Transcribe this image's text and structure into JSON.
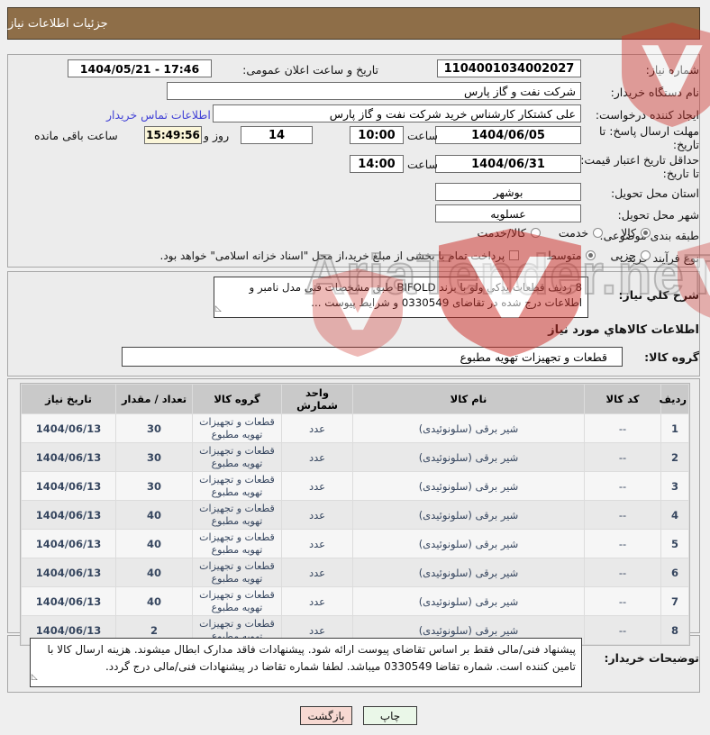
{
  "page": {
    "title_bar": "جزئیات اطلاعات نیاز"
  },
  "form": {
    "need_number": {
      "label": "شماره نیاز:",
      "value": "1104001034002027"
    },
    "announce": {
      "label": "تاریخ و ساعت اعلان عمومی:",
      "value": "1404/05/21 - 17:46"
    },
    "buyer_org": {
      "label": "نام دستگاه خریدار:",
      "value": "شرکت نفت و گاز پارس"
    },
    "creator": {
      "label": "ایجاد کننده درخواست:",
      "value": "علی کشتکار کارشناس خرید شرکت نفت و گاز پارس"
    },
    "contact_link": "اطلاعات تماس خریدار",
    "reply_deadline": {
      "label": "مهلت ارسال پاسخ: تا تاریخ:",
      "date": "1404/06/05",
      "hour_label": "ساعت",
      "time": "10:00"
    },
    "remaining": {
      "days": "14",
      "days_label": "روز و",
      "time": "15:49:56",
      "suffix_label": "ساعت باقی مانده"
    },
    "price_validity": {
      "label": "حداقل تاریخ اعتبار قیمت: تا تاریخ:",
      "date": "1404/06/31",
      "hour_label": "ساعت",
      "time": "14:00"
    },
    "province": {
      "label": "استان محل تحویل:",
      "value": "بوشهر"
    },
    "city": {
      "label": "شهر محل تحویل:",
      "value": "عسلویه"
    },
    "classification": {
      "label": "طبقه بندی موضوعی:",
      "options": [
        {
          "label": "کالا",
          "selected": true
        },
        {
          "label": "خدمت",
          "selected": false
        },
        {
          "label": "کالا/خدمت",
          "selected": false
        }
      ]
    },
    "process_type": {
      "label": "نوع فرآیند خرید :",
      "options": [
        {
          "label": "جزیی",
          "selected": false
        },
        {
          "label": "متوسط",
          "selected": true
        }
      ],
      "treasury": {
        "label": "پرداخت تمام یا بخشی از مبلغ خرید،از محل \"اسناد خزانه اسلامی\" خواهد بود.",
        "checked": false
      }
    }
  },
  "description": {
    "label": "شرح کلي نیاز:",
    "text": "8 ردیف قطعات یدکی ولو با برند BIFOLD طبق مشخصات فنی مدل نامبر و اطلاعات درج شده در تقاضای 0330549 و شرایط پیوست ..."
  },
  "goods_section": {
    "title": "اطلاعات کالاهاي مورد نیاز",
    "group_label": "گروه کالا:",
    "group_value": "قطعات و تجهیزات تهویه مطبوع"
  },
  "table": {
    "headers": [
      "ردیف",
      "کد کالا",
      "نام کالا",
      "واحد شمارش",
      "گروه کالا",
      "تعداد / مقدار",
      "تاریخ نیاز"
    ],
    "rows": [
      {
        "row": "1",
        "code": "--",
        "name": "شیر برقی (سلونوئیدی)",
        "unit": "عدد",
        "group": "قطعات و تجهیزات تهویه مطبوع",
        "qty": "30",
        "date": "1404/06/13"
      },
      {
        "row": "2",
        "code": "--",
        "name": "شیر برقی (سلونوئیدی)",
        "unit": "عدد",
        "group": "قطعات و تجهیزات تهویه مطبوع",
        "qty": "30",
        "date": "1404/06/13"
      },
      {
        "row": "3",
        "code": "--",
        "name": "شیر برقی (سلونوئیدی)",
        "unit": "عدد",
        "group": "قطعات و تجهیزات تهویه مطبوع",
        "qty": "30",
        "date": "1404/06/13"
      },
      {
        "row": "4",
        "code": "--",
        "name": "شیر برقی (سلونوئیدی)",
        "unit": "عدد",
        "group": "قطعات و تجهیزات تهویه مطبوع",
        "qty": "40",
        "date": "1404/06/13"
      },
      {
        "row": "5",
        "code": "--",
        "name": "شیر برقی (سلونوئیدی)",
        "unit": "عدد",
        "group": "قطعات و تجهیزات تهویه مطبوع",
        "qty": "40",
        "date": "1404/06/13"
      },
      {
        "row": "6",
        "code": "--",
        "name": "شیر برقی (سلونوئیدی)",
        "unit": "عدد",
        "group": "قطعات و تجهیزات تهویه مطبوع",
        "qty": "40",
        "date": "1404/06/13"
      },
      {
        "row": "7",
        "code": "--",
        "name": "شیر برقی (سلونوئیدی)",
        "unit": "عدد",
        "group": "قطعات و تجهیزات تهویه مطبوع",
        "qty": "40",
        "date": "1404/06/13"
      },
      {
        "row": "8",
        "code": "--",
        "name": "شیر برقی (سلونوئیدی)",
        "unit": "عدد",
        "group": "قطعات و تجهیزات تهویه مطبوع",
        "qty": "2",
        "date": "1404/06/13"
      }
    ]
  },
  "buyer_notes": {
    "label": "توضیحات خریدار:",
    "text": "پیشنهاد فنی/مالی فقط بر اساس تقاضای پیوست ارائه شود. پیشنهادات فاقد مدارک ابطال میشوند. هزینه ارسال کالا با تامین کننده است. شماره تقاضا 0330549  میباشد. لطفا شماره تقاضا در پیشنهادات فنی/مالی درج گردد."
  },
  "buttons": {
    "print": "چاپ",
    "back": "بازگشت"
  },
  "watermark": {
    "text": "AriaTender.neT"
  },
  "colors": {
    "title_bar_bg": "#8e6e48",
    "link": "#4343d6",
    "remaining_bg": "#fbf6d9",
    "print_btn_bg": "#eaf7e8",
    "back_btn_bg": "#f7d9d2",
    "watermark_red": "#cc2b24",
    "table_header_bg": "#c9c9c9"
  }
}
